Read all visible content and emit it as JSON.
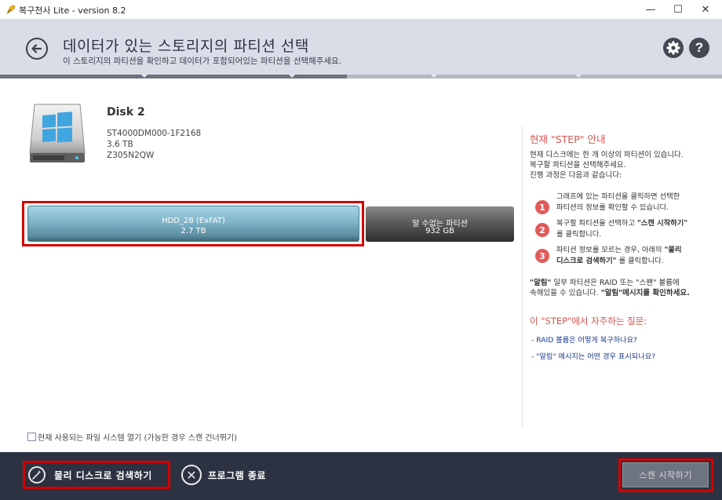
{
  "window": {
    "title": "복구천사 Lite - version 8.2",
    "controls": [
      "—",
      "☐",
      "✕"
    ]
  },
  "header": {
    "title": "데이터가 있는 스토리지의 파티션 선택",
    "subtitle": "이 스토리지의 파티션을 확인하고 데이터가 포함되어있는 파티션을 선택해주세요.",
    "help_label": "?",
    "progress_fraction": 0.48
  },
  "disk": {
    "name": "Disk 2",
    "model": "ST4000DM000-1F2168",
    "capacity": "3.6 TB",
    "serial": "Z305N2QW"
  },
  "partitions": [
    {
      "name": "HDD_28 (ExFAT)",
      "size": "2.7 TB",
      "selected": true,
      "color": "#7fb4c8"
    },
    {
      "name": "알 수없는 파티션",
      "size": "932 GB",
      "selected": false,
      "color": "#4a4a4a"
    }
  ],
  "guide": {
    "title": "현재 \"STEP\" 안내",
    "intro": [
      "현재 디스크에는 한 개 이상의 파티션이 있습니다.",
      "복구할 파티션을 선택해주세요.",
      "진행 과정은 다음과 같습니다:"
    ],
    "steps": [
      {
        "num": "1",
        "line1": "그래프에 있는 파티션을 클릭하면 선택한",
        "line2": "파티션의 정보를 확인할 수 있습니다."
      },
      {
        "num": "2",
        "line1a": "복구할 파티션을 선택하고 ",
        "line1b": "\"스캔 시작하기\"",
        "line2": "를 클릭합니다."
      },
      {
        "num": "3",
        "line1a": "파티션 정보를 모르는 경우, 아래의 ",
        "line1b": "\"물리",
        "line2a": "디스크로 검색하기\"",
        "line2b": " 를 클릭합니다."
      }
    ],
    "note": {
      "line1a": "\"알림\"",
      "line1b": " 일부 파티션은 RAID 또는 \"스팬\" 볼륨에",
      "line2a": "속해있을 수 있습니다. ",
      "line2b": "\"알림\"",
      "line2c": "메시지를 확인하세요."
    },
    "faq_title": "이 \"STEP\"에서 자주하는 질문:",
    "faq": [
      "- RAID 볼륨은 어떻게 복구하나요?",
      "- \"알림\" 메시지는 어떤 경우 표시되나요?"
    ]
  },
  "options": {
    "open_fs_label": "현재 사용되는 파일 시스템 열기 (가능한 경우 스캔 건너뛰기)",
    "open_fs_checked": false
  },
  "footer": {
    "search_physical_label": "물리 디스크로 검색하기",
    "exit_label": "프로그램 종료",
    "scan_label": "스캔 시작하기"
  },
  "colors": {
    "header_bg": "#d9dde8",
    "footer_bg": "#2c3241",
    "accent_red": "#d9534f",
    "highlight": "#d40000"
  }
}
